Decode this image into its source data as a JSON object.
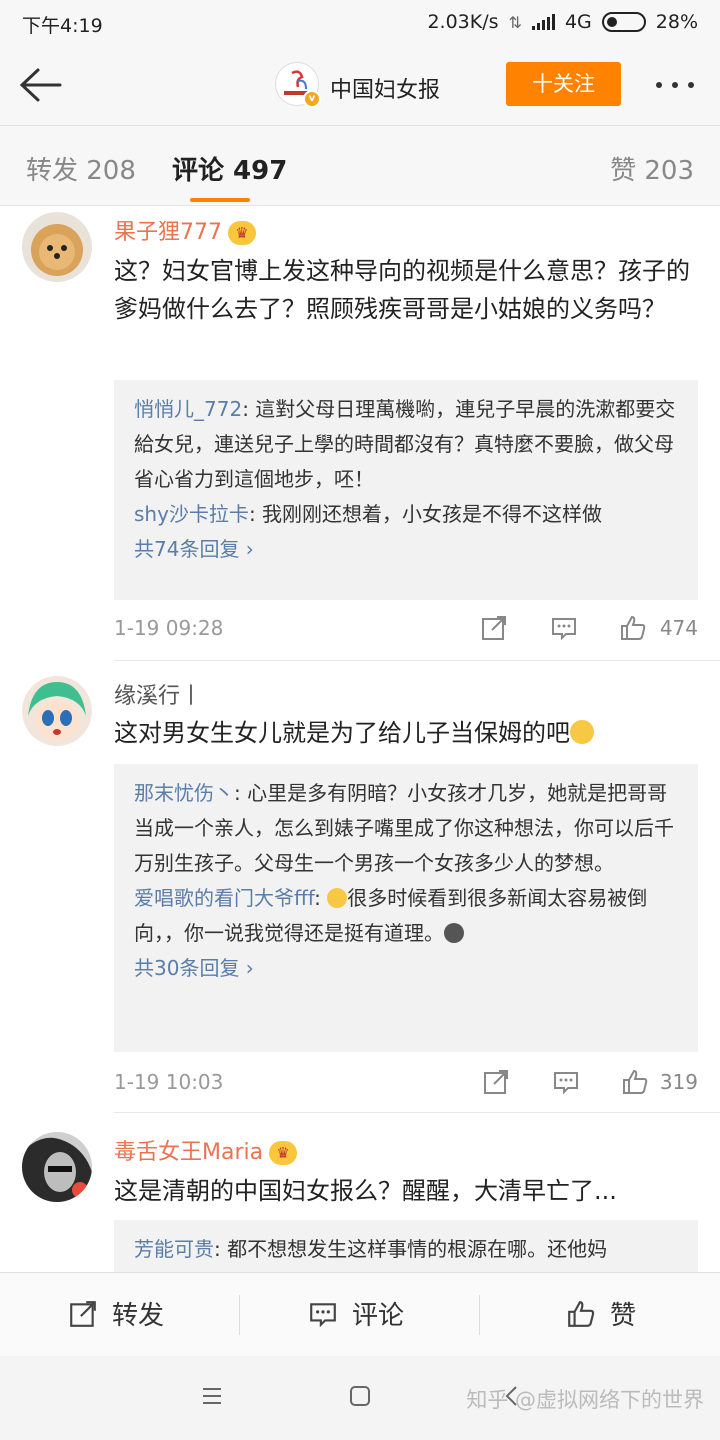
{
  "status_bar": {
    "time": "下午4:19",
    "speed": "2.03K/s",
    "network": "4G",
    "battery": "28%"
  },
  "header": {
    "account_name": "中国妇女报",
    "follow_label": "十关注"
  },
  "tabs": {
    "forward": "转发 208",
    "comment": "评论 497",
    "like": "赞 203"
  },
  "comments": [
    {
      "username": "果子狸777",
      "text": "这？妇女官博上发这种导向的视频是什么意思？孩子的爹妈做什么去了？照顾残疾哥哥是小姑娘的义务吗？",
      "replies": [
        {
          "name": "悄悄儿_772",
          "text": "這對父母日理萬機喲，連兒子早晨的洗漱都要交給女兒，連送兒子上學的時間都沒有？真特麼不要臉，做父母省心省力到這個地步，呸！"
        },
        {
          "name": "shy沙卡拉卡",
          "text": "我刚刚还想着，小女孩是不得不这样做"
        }
      ],
      "more_replies": "共74条回复 ›",
      "time": "1-19 09:28",
      "likes": "474"
    },
    {
      "username": "缘溪行丨",
      "text": "这对男女生女儿就是为了给儿子当保姆的吧",
      "replies": [
        {
          "name": "那末忧伤丶",
          "text": "心里是多有阴暗？小女孩才几岁，她就是把哥哥当成一个亲人，怎么到婊子嘴里成了你这种想法，你可以后千万别生孩子。父母生一个男孩一个女孩多少人的梦想。"
        },
        {
          "name": "爱唱歌的看门大爷fff",
          "text": "很多时候看到很多新闻太容易被倒向，，你一说我觉得还是挺有道理。"
        }
      ],
      "more_replies": "共30条回复 ›",
      "time": "1-19 10:03",
      "likes": "319"
    },
    {
      "username": "毒舌女王Maria",
      "text": "这是清朝的中国妇女报么？醒醒，大清早亡了...",
      "replies": [
        {
          "name": "芳能可贵",
          "text": "都不想想发生这样事情的根源在哪。还他妈"
        }
      ]
    }
  ],
  "bottom_bar": {
    "forward": "转发",
    "comment": "评论",
    "like": "赞"
  },
  "watermark": "知乎 @虚拟网络下的世界",
  "colors": {
    "accent": "#ff8200",
    "username_orange": "#eb7350",
    "reply_link": "#5a7ea8",
    "reply_bg": "#f2f2f2"
  }
}
